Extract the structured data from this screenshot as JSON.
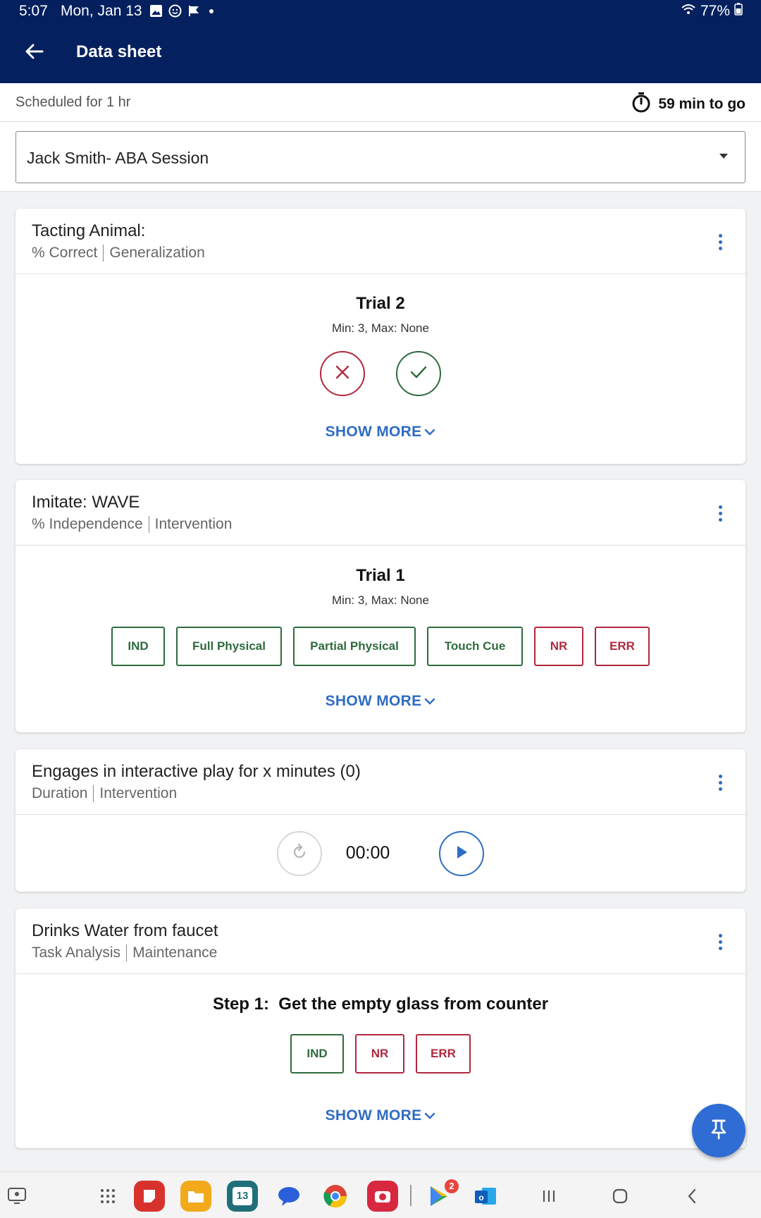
{
  "status_bar": {
    "time": "5:07",
    "date": "Mon, Jan 13",
    "notification_icons": [
      "gallery-icon",
      "emoji-icon",
      "flag-icon",
      "dot-icon"
    ],
    "battery": "77%",
    "wifi_icon": "wifi-icon"
  },
  "app_bar": {
    "title": "Data sheet",
    "back_icon": "arrow-left-icon"
  },
  "schedule": {
    "label": "Scheduled for 1 hr",
    "remaining": "59 min to go",
    "timer_icon": "stopwatch-icon"
  },
  "session_select": {
    "value": "Jack Smith- ABA Session"
  },
  "cards": [
    {
      "title": "Tacting Animal:",
      "measure": "% Correct",
      "phase": "Generalization",
      "trial_title": "Trial 2",
      "trial_sub": "Min: 3, Max: None",
      "show_more": "SHOW MORE"
    },
    {
      "title": "Imitate: WAVE",
      "measure": "% Independence",
      "phase": "Intervention",
      "trial_title": "Trial 1",
      "trial_sub": "Min: 3, Max: None",
      "options": [
        "IND",
        "Full Physical",
        "Partial Physical",
        "Touch Cue",
        "NR",
        "ERR"
      ],
      "show_more": "SHOW MORE"
    },
    {
      "title": "Engages in interactive play for x minutes (0)",
      "measure": "Duration",
      "phase": "Intervention",
      "timer_value": "00:00"
    },
    {
      "title": "Drinks Water from faucet",
      "measure": "Task Analysis",
      "phase": "Maintenance",
      "step_label": "Step 1:",
      "step_text": "Get the empty glass from counter",
      "options": [
        "IND",
        "NR",
        "ERR"
      ],
      "show_more": "SHOW MORE"
    }
  ],
  "nav_bar": {
    "badge_count": "2",
    "calendar_day": "13"
  },
  "colors": {
    "primary_dark": "#04205e",
    "accent_blue": "#2f6cc3",
    "success_green": "#2e6b3e",
    "error_red": "#b0283e"
  }
}
